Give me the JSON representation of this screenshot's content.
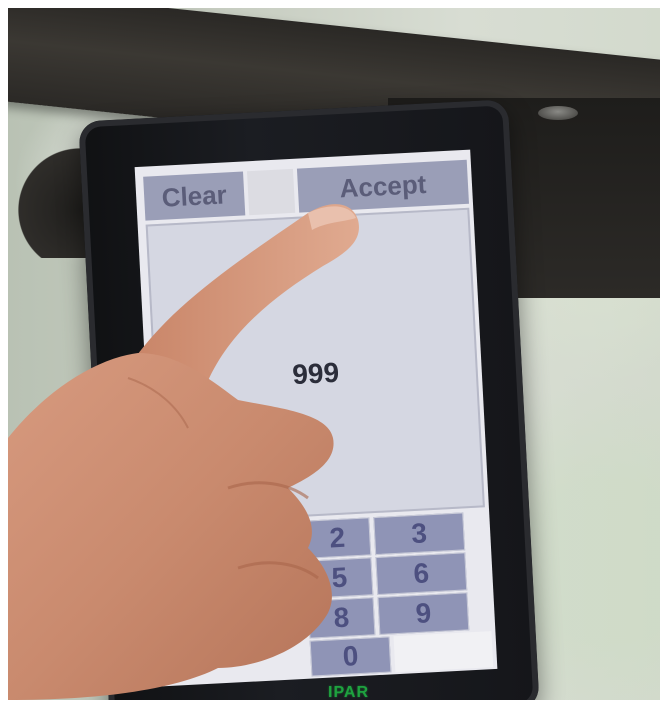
{
  "buttons": {
    "clear": "Clear",
    "accept": "Accept"
  },
  "display": {
    "value": "999"
  },
  "keypad": [
    "2",
    "3",
    "5",
    "6",
    "8",
    "9",
    "0"
  ],
  "logo": "IPAR",
  "colors": {
    "button_bg": "#9a9eb7",
    "key_bg": "#8f94b6",
    "logo": "#1ea23f"
  }
}
